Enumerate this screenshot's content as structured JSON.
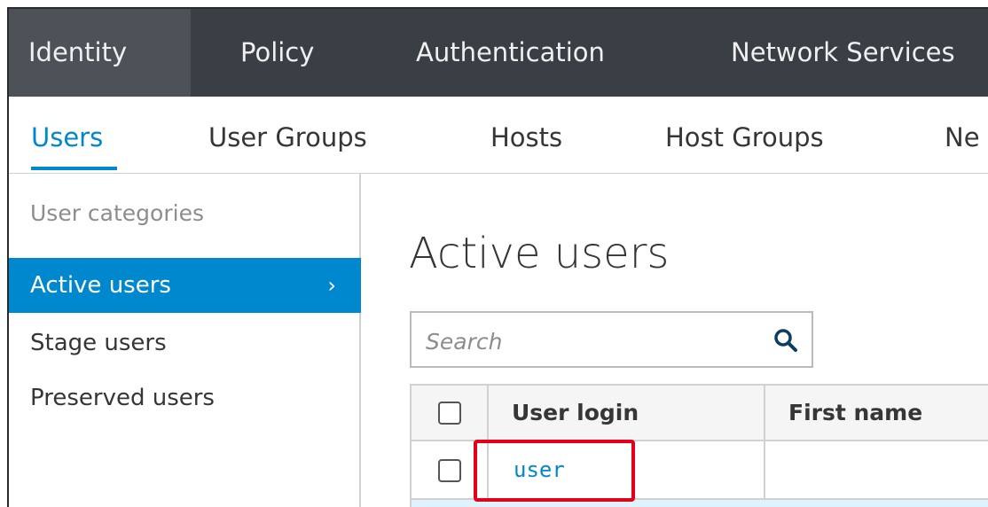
{
  "top_nav": {
    "items": [
      {
        "label": "Identity",
        "active": true
      },
      {
        "label": "Policy"
      },
      {
        "label": "Authentication"
      },
      {
        "label": "Network Services"
      }
    ]
  },
  "sub_nav": {
    "items": [
      {
        "label": "Users",
        "active": true
      },
      {
        "label": "User Groups"
      },
      {
        "label": "Hosts"
      },
      {
        "label": "Host Groups"
      },
      {
        "label": "Ne"
      }
    ]
  },
  "sidebar": {
    "heading": "User categories",
    "items": [
      {
        "label": "Active users",
        "active": true,
        "icon": "chevron-right-icon",
        "glyph": "›"
      },
      {
        "label": "Stage users"
      },
      {
        "label": "Preserved users"
      }
    ]
  },
  "main": {
    "title": "Active users",
    "search": {
      "placeholder": "Search",
      "value": "",
      "icon": "search-icon"
    },
    "table": {
      "columns": [
        "User login",
        "First name"
      ],
      "rows": [
        {
          "user_login": "user",
          "first_name": ""
        }
      ]
    }
  },
  "colors": {
    "top_nav_bg": "#393f44",
    "accent": "#0088ce",
    "highlight": "#e4001a"
  }
}
